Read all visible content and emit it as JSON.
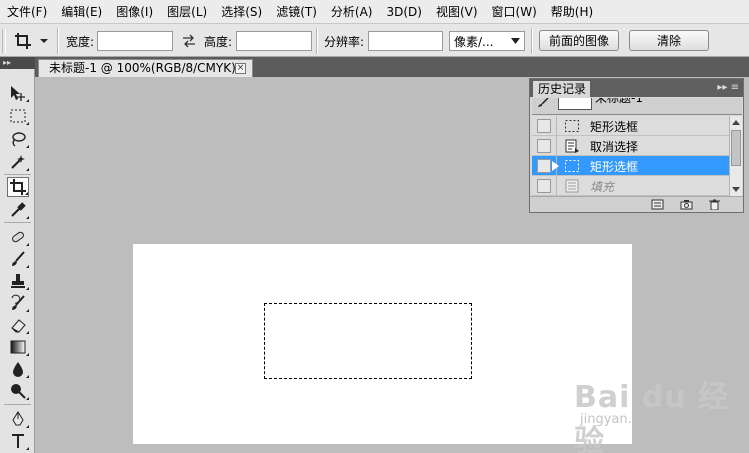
{
  "menu": [
    "文件(F)",
    "编辑(E)",
    "图像(I)",
    "图层(L)",
    "选择(S)",
    "滤镜(T)",
    "分析(A)",
    "3D(D)",
    "视图(V)",
    "窗口(W)",
    "帮助(H)"
  ],
  "options": {
    "width_label": "宽度:",
    "height_label": "高度:",
    "resolution_label": "分辨率:",
    "unit_value": "像素/...",
    "front_image_button": "前面的图像",
    "clear_button": "清除",
    "width_value": "",
    "height_value": "",
    "resolution_value": ""
  },
  "document": {
    "tab_title": "未标题-1 @ 100%(RGB/8/CMYK) *",
    "close_glyph": "×"
  },
  "history": {
    "tab_label": "历史记录",
    "snapshot_label": "未标题-1",
    "items": [
      {
        "label": "矩形选框",
        "icon": "rect-marquee-icon",
        "state": "normal"
      },
      {
        "label": "取消选择",
        "icon": "deselect-document-icon",
        "state": "normal"
      },
      {
        "label": "矩形选框",
        "icon": "rect-marquee-icon",
        "state": "selected"
      },
      {
        "label": "填充",
        "icon": "fill-icon",
        "state": "dimmed"
      }
    ]
  },
  "watermark": {
    "brand": "Bai du 经验",
    "url": "jingyan.baidu.com"
  },
  "colors": {
    "selection_blue": "#3399ff",
    "workspace_gray": "#bdbdbd"
  }
}
